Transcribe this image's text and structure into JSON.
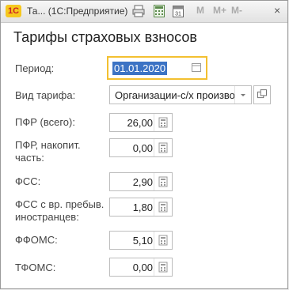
{
  "window": {
    "logo": "1С",
    "title": "Та...  (1С:Предприятие)",
    "mem_buttons": [
      "M",
      "M+",
      "M-"
    ],
    "close": "×"
  },
  "form": {
    "title": "Тарифы страховых взносов",
    "period": {
      "label": "Период:",
      "value": "01.01.2020"
    },
    "tariff": {
      "label": "Вид тарифа:",
      "value": "Организации-с/х производ"
    },
    "fields": [
      {
        "label": "ПФР (всего):",
        "value": "26,00"
      },
      {
        "label": "ПФР, накопит.\nчасть:",
        "value": "0,00"
      },
      {
        "label": "ФСС:",
        "value": "2,90"
      },
      {
        "label": "ФСС с вр. пребыв.\nиностранцев:",
        "value": "1,80"
      },
      {
        "label": "ФФОМС:",
        "value": "5,10"
      },
      {
        "label": "ТФОМС:",
        "value": "0,00"
      }
    ]
  }
}
